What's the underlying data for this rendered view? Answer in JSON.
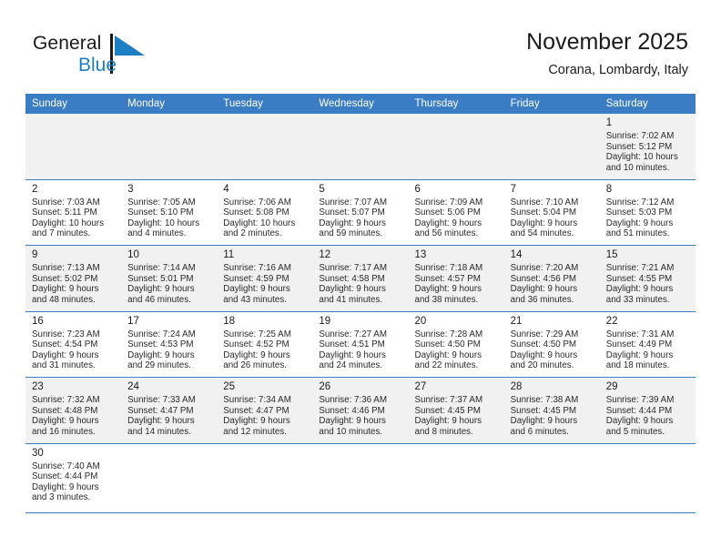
{
  "brand": {
    "name_part1": "General",
    "name_part2": "Blue",
    "logo_icon": "blue-triangle-flag-icon",
    "accent_color": "#1d7fc3"
  },
  "header": {
    "title": "November 2025",
    "subtitle": "Corana, Lombardy, Italy"
  },
  "calendar": {
    "header_color": "#3b7dc4",
    "shaded_row_color": "#f1f1f1",
    "weekdays": [
      "Sunday",
      "Monday",
      "Tuesday",
      "Wednesday",
      "Thursday",
      "Friday",
      "Saturday"
    ],
    "weeks": [
      {
        "shaded": true,
        "days": [
          {
            "empty": true
          },
          {
            "empty": true
          },
          {
            "empty": true
          },
          {
            "empty": true
          },
          {
            "empty": true
          },
          {
            "empty": true
          },
          {
            "date": "1",
            "sunrise": "Sunrise: 7:02 AM",
            "sunset": "Sunset: 5:12 PM",
            "daylight_line1": "Daylight: 10 hours",
            "daylight_line2": "and 10 minutes."
          }
        ]
      },
      {
        "shaded": false,
        "days": [
          {
            "date": "2",
            "sunrise": "Sunrise: 7:03 AM",
            "sunset": "Sunset: 5:11 PM",
            "daylight_line1": "Daylight: 10 hours",
            "daylight_line2": "and 7 minutes."
          },
          {
            "date": "3",
            "sunrise": "Sunrise: 7:05 AM",
            "sunset": "Sunset: 5:10 PM",
            "daylight_line1": "Daylight: 10 hours",
            "daylight_line2": "and 4 minutes."
          },
          {
            "date": "4",
            "sunrise": "Sunrise: 7:06 AM",
            "sunset": "Sunset: 5:08 PM",
            "daylight_line1": "Daylight: 10 hours",
            "daylight_line2": "and 2 minutes."
          },
          {
            "date": "5",
            "sunrise": "Sunrise: 7:07 AM",
            "sunset": "Sunset: 5:07 PM",
            "daylight_line1": "Daylight: 9 hours",
            "daylight_line2": "and 59 minutes."
          },
          {
            "date": "6",
            "sunrise": "Sunrise: 7:09 AM",
            "sunset": "Sunset: 5:06 PM",
            "daylight_line1": "Daylight: 9 hours",
            "daylight_line2": "and 56 minutes."
          },
          {
            "date": "7",
            "sunrise": "Sunrise: 7:10 AM",
            "sunset": "Sunset: 5:04 PM",
            "daylight_line1": "Daylight: 9 hours",
            "daylight_line2": "and 54 minutes."
          },
          {
            "date": "8",
            "sunrise": "Sunrise: 7:12 AM",
            "sunset": "Sunset: 5:03 PM",
            "daylight_line1": "Daylight: 9 hours",
            "daylight_line2": "and 51 minutes."
          }
        ]
      },
      {
        "shaded": true,
        "days": [
          {
            "date": "9",
            "sunrise": "Sunrise: 7:13 AM",
            "sunset": "Sunset: 5:02 PM",
            "daylight_line1": "Daylight: 9 hours",
            "daylight_line2": "and 48 minutes."
          },
          {
            "date": "10",
            "sunrise": "Sunrise: 7:14 AM",
            "sunset": "Sunset: 5:01 PM",
            "daylight_line1": "Daylight: 9 hours",
            "daylight_line2": "and 46 minutes."
          },
          {
            "date": "11",
            "sunrise": "Sunrise: 7:16 AM",
            "sunset": "Sunset: 4:59 PM",
            "daylight_line1": "Daylight: 9 hours",
            "daylight_line2": "and 43 minutes."
          },
          {
            "date": "12",
            "sunrise": "Sunrise: 7:17 AM",
            "sunset": "Sunset: 4:58 PM",
            "daylight_line1": "Daylight: 9 hours",
            "daylight_line2": "and 41 minutes."
          },
          {
            "date": "13",
            "sunrise": "Sunrise: 7:18 AM",
            "sunset": "Sunset: 4:57 PM",
            "daylight_line1": "Daylight: 9 hours",
            "daylight_line2": "and 38 minutes."
          },
          {
            "date": "14",
            "sunrise": "Sunrise: 7:20 AM",
            "sunset": "Sunset: 4:56 PM",
            "daylight_line1": "Daylight: 9 hours",
            "daylight_line2": "and 36 minutes."
          },
          {
            "date": "15",
            "sunrise": "Sunrise: 7:21 AM",
            "sunset": "Sunset: 4:55 PM",
            "daylight_line1": "Daylight: 9 hours",
            "daylight_line2": "and 33 minutes."
          }
        ]
      },
      {
        "shaded": false,
        "days": [
          {
            "date": "16",
            "sunrise": "Sunrise: 7:23 AM",
            "sunset": "Sunset: 4:54 PM",
            "daylight_line1": "Daylight: 9 hours",
            "daylight_line2": "and 31 minutes."
          },
          {
            "date": "17",
            "sunrise": "Sunrise: 7:24 AM",
            "sunset": "Sunset: 4:53 PM",
            "daylight_line1": "Daylight: 9 hours",
            "daylight_line2": "and 29 minutes."
          },
          {
            "date": "18",
            "sunrise": "Sunrise: 7:25 AM",
            "sunset": "Sunset: 4:52 PM",
            "daylight_line1": "Daylight: 9 hours",
            "daylight_line2": "and 26 minutes."
          },
          {
            "date": "19",
            "sunrise": "Sunrise: 7:27 AM",
            "sunset": "Sunset: 4:51 PM",
            "daylight_line1": "Daylight: 9 hours",
            "daylight_line2": "and 24 minutes."
          },
          {
            "date": "20",
            "sunrise": "Sunrise: 7:28 AM",
            "sunset": "Sunset: 4:50 PM",
            "daylight_line1": "Daylight: 9 hours",
            "daylight_line2": "and 22 minutes."
          },
          {
            "date": "21",
            "sunrise": "Sunrise: 7:29 AM",
            "sunset": "Sunset: 4:50 PM",
            "daylight_line1": "Daylight: 9 hours",
            "daylight_line2": "and 20 minutes."
          },
          {
            "date": "22",
            "sunrise": "Sunrise: 7:31 AM",
            "sunset": "Sunset: 4:49 PM",
            "daylight_line1": "Daylight: 9 hours",
            "daylight_line2": "and 18 minutes."
          }
        ]
      },
      {
        "shaded": true,
        "days": [
          {
            "date": "23",
            "sunrise": "Sunrise: 7:32 AM",
            "sunset": "Sunset: 4:48 PM",
            "daylight_line1": "Daylight: 9 hours",
            "daylight_line2": "and 16 minutes."
          },
          {
            "date": "24",
            "sunrise": "Sunrise: 7:33 AM",
            "sunset": "Sunset: 4:47 PM",
            "daylight_line1": "Daylight: 9 hours",
            "daylight_line2": "and 14 minutes."
          },
          {
            "date": "25",
            "sunrise": "Sunrise: 7:34 AM",
            "sunset": "Sunset: 4:47 PM",
            "daylight_line1": "Daylight: 9 hours",
            "daylight_line2": "and 12 minutes."
          },
          {
            "date": "26",
            "sunrise": "Sunrise: 7:36 AM",
            "sunset": "Sunset: 4:46 PM",
            "daylight_line1": "Daylight: 9 hours",
            "daylight_line2": "and 10 minutes."
          },
          {
            "date": "27",
            "sunrise": "Sunrise: 7:37 AM",
            "sunset": "Sunset: 4:45 PM",
            "daylight_line1": "Daylight: 9 hours",
            "daylight_line2": "and 8 minutes."
          },
          {
            "date": "28",
            "sunrise": "Sunrise: 7:38 AM",
            "sunset": "Sunset: 4:45 PM",
            "daylight_line1": "Daylight: 9 hours",
            "daylight_line2": "and 6 minutes."
          },
          {
            "date": "29",
            "sunrise": "Sunrise: 7:39 AM",
            "sunset": "Sunset: 4:44 PM",
            "daylight_line1": "Daylight: 9 hours",
            "daylight_line2": "and 5 minutes."
          }
        ]
      },
      {
        "shaded": false,
        "days": [
          {
            "date": "30",
            "sunrise": "Sunrise: 7:40 AM",
            "sunset": "Sunset: 4:44 PM",
            "daylight_line1": "Daylight: 9 hours",
            "daylight_line2": "and 3 minutes."
          },
          {
            "empty": true
          },
          {
            "empty": true
          },
          {
            "empty": true
          },
          {
            "empty": true
          },
          {
            "empty": true
          },
          {
            "empty": true
          }
        ]
      }
    ]
  }
}
